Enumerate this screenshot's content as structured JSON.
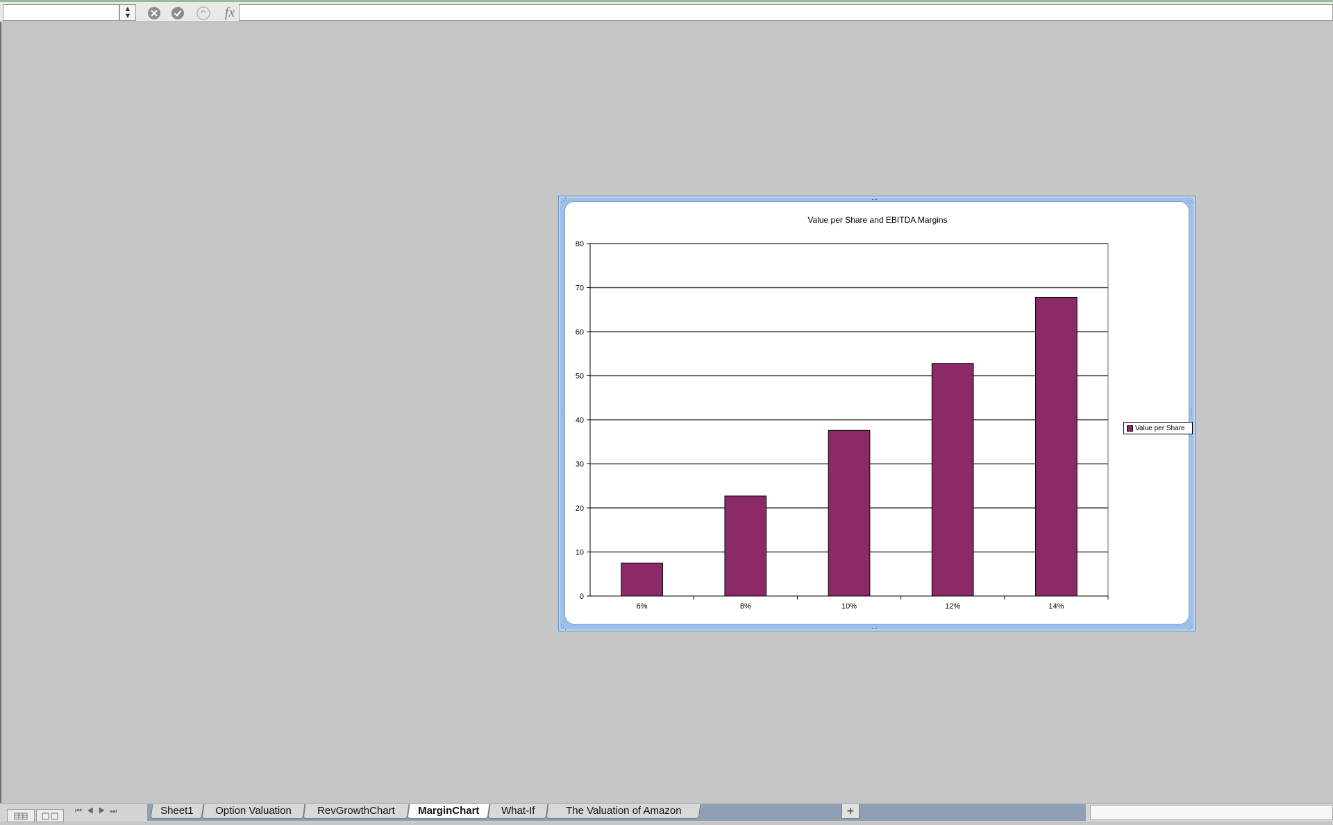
{
  "formula_bar": {
    "name_box_value": "",
    "formula_value": "",
    "fx_label": "fx",
    "icons": [
      "cancel-icon",
      "confirm-icon",
      "function-wizard-icon"
    ]
  },
  "chart_data": {
    "type": "bar",
    "title": "Value per Share and EBITDA Margins",
    "categories": [
      "6%",
      "8%",
      "10%",
      "12%",
      "14%"
    ],
    "series": [
      {
        "name": "Value per Share",
        "values": [
          7.5,
          22.7,
          37.6,
          52.8,
          67.8
        ],
        "color": "#8b2a67"
      }
    ],
    "ylim": [
      0,
      80
    ],
    "yticks": [
      0,
      10,
      20,
      30,
      40,
      50,
      60,
      70,
      80
    ],
    "xlabel": "",
    "ylabel": "",
    "grid": true,
    "legend_position": "right"
  },
  "sheet_tabs": [
    {
      "label": "Sheet1",
      "active": false
    },
    {
      "label": "Option Valuation",
      "active": false
    },
    {
      "label": "RevGrowthChart",
      "active": false
    },
    {
      "label": "MarginChart",
      "active": true
    },
    {
      "label": "What-If",
      "active": false
    },
    {
      "label": "The Valuation of Amazon",
      "active": false
    }
  ],
  "add_sheet_label": "+",
  "colors": {
    "bar": "#8b2a67",
    "frame": "#9cc0ea",
    "background": "#c6c6c6"
  }
}
